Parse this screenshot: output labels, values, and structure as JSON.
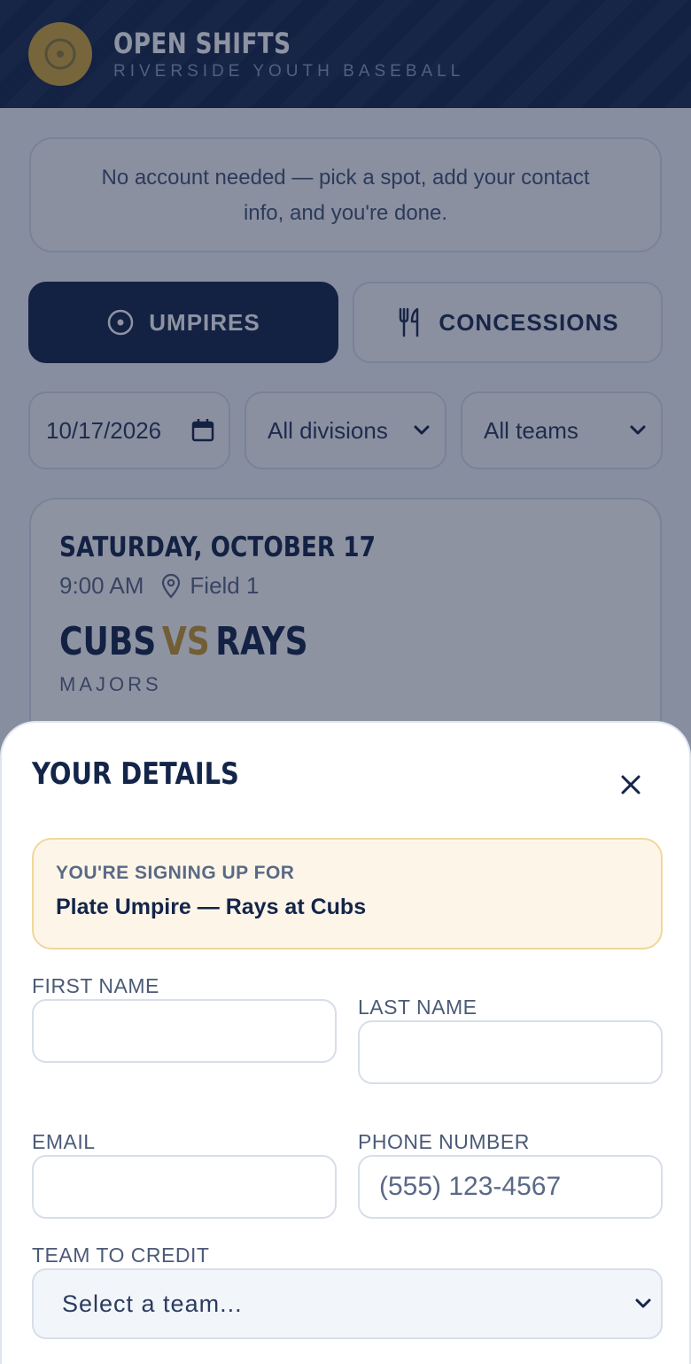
{
  "header": {
    "title": "OPEN SHIFTS",
    "subtitle": "RIVERSIDE YOUTH BASEBALL",
    "logo_icon": "target-icon",
    "logo_color": "#d4a93a",
    "bg_color": "#14254a"
  },
  "notice": {
    "line1": "No account needed — pick a spot, add your contact",
    "line2": "info, and you're done."
  },
  "tabs": [
    {
      "label": "UMPIRES",
      "icon": "target-icon",
      "active": true
    },
    {
      "label": "CONCESSIONS",
      "icon": "utensils-icon",
      "active": false
    }
  ],
  "filters": {
    "date": "10/17/2026",
    "division": "All divisions",
    "team": "All teams"
  },
  "game": {
    "date": "SATURDAY, OCTOBER 17",
    "time": "9:00 AM",
    "field": "Field 1",
    "home": "CUBS",
    "vs": "VS",
    "away": "RAYS",
    "division": "MAJORS"
  },
  "sheet": {
    "title": "YOUR DETAILS",
    "signup_label": "YOU'RE SIGNING UP FOR",
    "signup_value": "Plate Umpire — Rays at Cubs",
    "fields": {
      "first_name": {
        "label": "FIRST NAME",
        "value": "",
        "placeholder": ""
      },
      "last_name": {
        "label": "LAST NAME",
        "value": "",
        "placeholder": ""
      },
      "email": {
        "label": "EMAIL",
        "value": "",
        "placeholder": ""
      },
      "phone": {
        "label": "PHONE NUMBER",
        "value": "",
        "placeholder": "(555) 123-4567"
      },
      "team": {
        "label": "TEAM TO CREDIT",
        "selected": "Select a team..."
      }
    }
  },
  "colors": {
    "navy": "#14254a",
    "gold": "#c99a2e",
    "signup_bg": "#fdf6e8",
    "signup_border": "#f0d79a"
  }
}
